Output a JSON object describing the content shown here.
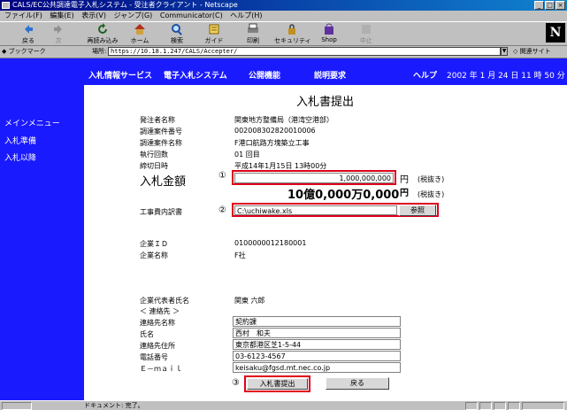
{
  "window": {
    "title": "CALS/EC公共調達電子入札システム - 受注者クライアント - Netscape",
    "buttons": [
      "_",
      "□",
      "×"
    ]
  },
  "menu": [
    "ファイル(F)",
    "編集(E)",
    "表示(V)",
    "ジャンプ(G)",
    "Communicator(C)",
    "ヘルプ(H)"
  ],
  "toolbar": [
    {
      "label": "戻る",
      "icon": "back-icon"
    },
    {
      "label": "次",
      "icon": "forward-icon"
    },
    {
      "label": "再読み込み",
      "icon": "reload-icon"
    },
    {
      "label": "ホーム",
      "icon": "home-icon"
    },
    {
      "label": "検索",
      "icon": "search-icon"
    },
    {
      "label": "ガイド",
      "icon": "guide-icon"
    },
    {
      "label": "印刷",
      "icon": "print-icon"
    },
    {
      "label": "セキュリティ",
      "icon": "security-icon"
    },
    {
      "label": "Shop",
      "icon": "shop-icon"
    },
    {
      "label": "中止",
      "icon": "stop-icon"
    }
  ],
  "locationbar": {
    "bookmark": "ブックマーク",
    "label": "場所:",
    "url": "https://10.18.1.247/CALS/Accepter/",
    "related": "関連サイト"
  },
  "logo_letter": "N",
  "sidebar": [
    "メインメニュー",
    "入札準備",
    "入札以降"
  ],
  "topnav": {
    "items": [
      "入札情報サービス",
      "電子入札システム",
      "公開機能",
      "説明要求"
    ],
    "help": "ヘルプ",
    "date": "2002 年 1 月 24 日 11 時 50 分"
  },
  "form": {
    "heading": "入札書提出",
    "rows": [
      {
        "label": "発注者名称",
        "value": "関東地方整備局（港湾空港部）"
      },
      {
        "label": "調達案件番号",
        "value": "002008302820010006"
      },
      {
        "label": "調達案件名称",
        "value": "F港口航路方塊築立工事"
      },
      {
        "label": "執行回数",
        "value": "01 回目"
      },
      {
        "label": "締切日時",
        "value": "平成14年1月15日 13時00分"
      }
    ],
    "bid_label": "入札金額",
    "bid_marker": "①",
    "bid_amount": "1,000,000,000",
    "currency": "円",
    "tax_note": "(税抜き)",
    "bid_amount_kanji": "10億0,000万0,000",
    "tax_note2": "(税抜き)",
    "breakdown_label": "工事費内訳書",
    "breakdown_marker": "②",
    "breakdown_file": "C:\\uchiwake.xls",
    "browse_button": "参照",
    "company_id_label": "企業ＩＤ",
    "company_id": "0100000012180001",
    "company_name_label": "企業名称",
    "company_name": "F社",
    "rep_label": "企業代表者氏名",
    "rep_name": "関東 六郎",
    "contact_header": "＜ 連絡先 ＞",
    "contact": [
      {
        "label": "連絡先名称",
        "value": "契約課"
      },
      {
        "label": "氏名",
        "value": "西村　和夫"
      },
      {
        "label": "連絡先住所",
        "value": "東京都港区芝1-5-44"
      },
      {
        "label": "電話番号",
        "value": "03-6123-4567"
      },
      {
        "label": "Ｅ－ｍａｉｌ",
        "value": "keisaku@fgsd.mt.nec.co.jp"
      }
    ],
    "submit_marker": "③",
    "submit_button": "入札書提出",
    "back_button": "戻る"
  },
  "status": {
    "text": "ドキュメント: 完了。"
  },
  "colors": {
    "accent_blue": "#1a1aff",
    "highlight_red": "#e0001a"
  }
}
